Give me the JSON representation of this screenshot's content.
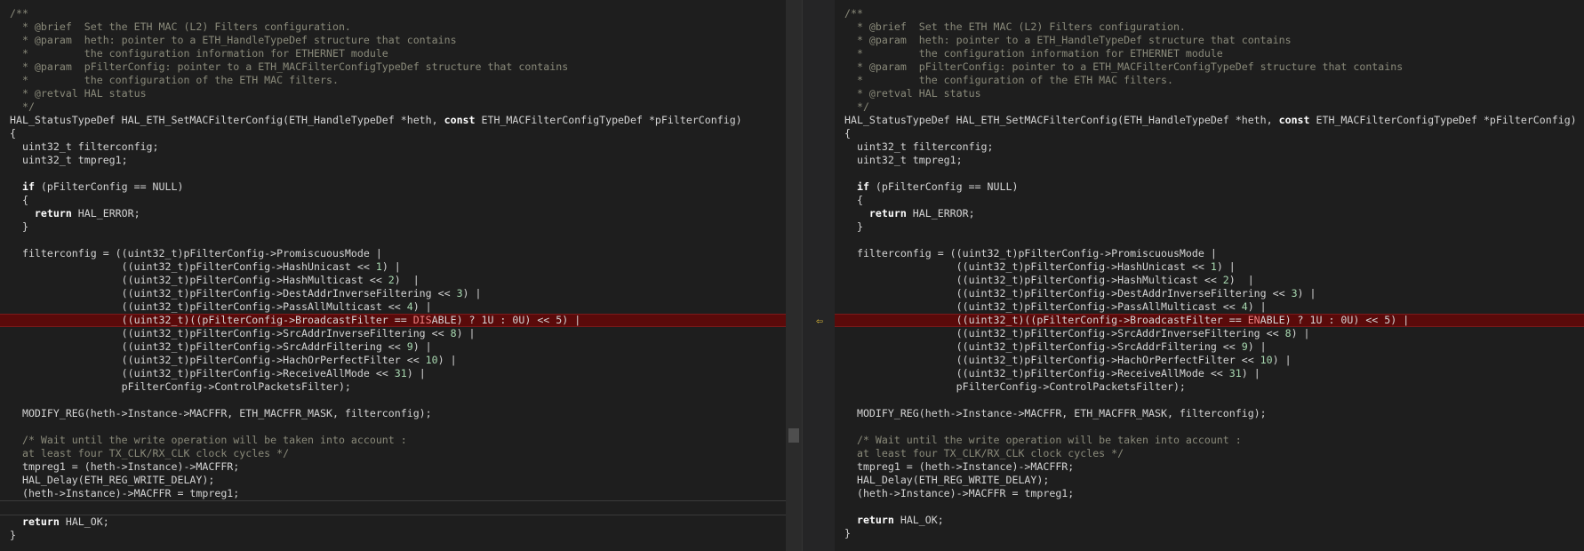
{
  "left": {
    "lines": [
      {
        "segs": [
          {
            "t": "/**",
            "c": "cm"
          }
        ]
      },
      {
        "segs": [
          {
            "t": "  * @brief  Set the ETH MAC (L2) Filters configuration.",
            "c": "cm"
          }
        ]
      },
      {
        "segs": [
          {
            "t": "  * @param  heth: pointer to a ETH_HandleTypeDef structure that contains",
            "c": "cm"
          }
        ]
      },
      {
        "segs": [
          {
            "t": "  *         the configuration information for ETHERNET module",
            "c": "cm"
          }
        ]
      },
      {
        "segs": [
          {
            "t": "  * @param  pFilterConfig: pointer to a ETH_MACFilterConfigTypeDef structure that contains",
            "c": "cm"
          }
        ]
      },
      {
        "segs": [
          {
            "t": "  *         the configuration of the ETH MAC filters.",
            "c": "cm"
          }
        ]
      },
      {
        "segs": [
          {
            "t": "  * @retval HAL status",
            "c": "cm"
          }
        ]
      },
      {
        "segs": [
          {
            "t": "  */",
            "c": "cm"
          }
        ]
      },
      {
        "segs": [
          {
            "t": "HAL_StatusTypeDef HAL_ETH_SetMACFilterConfig(ETH_HandleTypeDef *heth, "
          },
          {
            "t": "const",
            "c": "kw"
          },
          {
            "t": " ETH_MACFilterConfigTypeDef *pFilterConfig)"
          }
        ]
      },
      {
        "segs": [
          {
            "t": "{"
          }
        ]
      },
      {
        "segs": [
          {
            "t": "  uint32_t filterconfig;"
          }
        ]
      },
      {
        "segs": [
          {
            "t": "  uint32_t tmpreg1;"
          }
        ]
      },
      {
        "segs": [
          {
            "t": ""
          }
        ]
      },
      {
        "segs": [
          {
            "t": "  "
          },
          {
            "t": "if",
            "c": "kw"
          },
          {
            "t": " (pFilterConfig == NULL)"
          }
        ]
      },
      {
        "segs": [
          {
            "t": "  {"
          }
        ]
      },
      {
        "segs": [
          {
            "t": "    "
          },
          {
            "t": "return",
            "c": "kw"
          },
          {
            "t": " HAL_ERROR;"
          }
        ]
      },
      {
        "segs": [
          {
            "t": "  }"
          }
        ]
      },
      {
        "segs": [
          {
            "t": ""
          }
        ]
      },
      {
        "segs": [
          {
            "t": "  filterconfig = ((uint32_t)pFilterConfig->PromiscuousMode |"
          }
        ]
      },
      {
        "segs": [
          {
            "t": "                  ((uint32_t)pFilterConfig->HashUnicast << "
          },
          {
            "t": "1",
            "c": "num"
          },
          {
            "t": ") |"
          }
        ]
      },
      {
        "segs": [
          {
            "t": "                  ((uint32_t)pFilterConfig->HashMulticast << "
          },
          {
            "t": "2",
            "c": "num"
          },
          {
            "t": ")  |"
          }
        ]
      },
      {
        "segs": [
          {
            "t": "                  ((uint32_t)pFilterConfig->DestAddrInverseFiltering << "
          },
          {
            "t": "3",
            "c": "num"
          },
          {
            "t": ") |"
          }
        ]
      },
      {
        "segs": [
          {
            "t": "                  ((uint32_t)pFilterConfig->PassAllMulticast << "
          },
          {
            "t": "4",
            "c": "num"
          },
          {
            "t": ") |"
          }
        ]
      },
      {
        "changed": true,
        "segs": [
          {
            "t": "                  ((uint32_t)((pFilterConfig->BroadcastFilter == "
          },
          {
            "t": "DIS",
            "c": "hl-del"
          },
          {
            "t": "ABLE) ? 1U : 0U) << 5) |"
          }
        ]
      },
      {
        "segs": [
          {
            "t": "                  ((uint32_t)pFilterConfig->SrcAddrInverseFiltering << "
          },
          {
            "t": "8",
            "c": "num"
          },
          {
            "t": ") |"
          }
        ]
      },
      {
        "segs": [
          {
            "t": "                  ((uint32_t)pFilterConfig->SrcAddrFiltering << "
          },
          {
            "t": "9",
            "c": "num"
          },
          {
            "t": ") |"
          }
        ]
      },
      {
        "segs": [
          {
            "t": "                  ((uint32_t)pFilterConfig->HachOrPerfectFilter << "
          },
          {
            "t": "10",
            "c": "num"
          },
          {
            "t": ") |"
          }
        ]
      },
      {
        "segs": [
          {
            "t": "                  ((uint32_t)pFilterConfig->ReceiveAllMode << "
          },
          {
            "t": "31",
            "c": "num"
          },
          {
            "t": ") |"
          }
        ]
      },
      {
        "segs": [
          {
            "t": "                  pFilterConfig->ControlPacketsFilter);"
          }
        ]
      },
      {
        "segs": [
          {
            "t": ""
          }
        ]
      },
      {
        "segs": [
          {
            "t": "  MODIFY_REG(heth->Instance->MACFFR, ETH_MACFFR_MASK, filterconfig);"
          }
        ]
      },
      {
        "segs": [
          {
            "t": ""
          }
        ]
      },
      {
        "segs": [
          {
            "t": "  /* Wait until the write operation will be taken into account :",
            "c": "cm"
          }
        ]
      },
      {
        "segs": [
          {
            "t": "  at least four TX_CLK/RX_CLK clock cycles */",
            "c": "cm"
          }
        ]
      },
      {
        "segs": [
          {
            "t": "  tmpreg1 = (heth->Instance)->MACFFR;"
          }
        ]
      },
      {
        "segs": [
          {
            "t": "  HAL_Delay(ETH_REG_WRITE_DELAY);"
          }
        ]
      },
      {
        "sep": true,
        "segs": [
          {
            "t": "  (heth->Instance)->MACFFR = tmpreg1;"
          }
        ]
      },
      {
        "sep": true,
        "segs": [
          {
            "t": ""
          }
        ]
      },
      {
        "segs": [
          {
            "t": "  "
          },
          {
            "t": "return",
            "c": "kw"
          },
          {
            "t": " HAL_OK;"
          }
        ]
      },
      {
        "segs": [
          {
            "t": "}"
          }
        ]
      }
    ]
  },
  "right": {
    "lines": [
      {
        "segs": [
          {
            "t": "/**",
            "c": "cm"
          }
        ]
      },
      {
        "segs": [
          {
            "t": "  * @brief  Set the ETH MAC (L2) Filters configuration.",
            "c": "cm"
          }
        ]
      },
      {
        "segs": [
          {
            "t": "  * @param  heth: pointer to a ETH_HandleTypeDef structure that contains",
            "c": "cm"
          }
        ]
      },
      {
        "segs": [
          {
            "t": "  *         the configuration information for ETHERNET module",
            "c": "cm"
          }
        ]
      },
      {
        "segs": [
          {
            "t": "  * @param  pFilterConfig: pointer to a ETH_MACFilterConfigTypeDef structure that contains",
            "c": "cm"
          }
        ]
      },
      {
        "segs": [
          {
            "t": "  *         the configuration of the ETH MAC filters.",
            "c": "cm"
          }
        ]
      },
      {
        "segs": [
          {
            "t": "  * @retval HAL status",
            "c": "cm"
          }
        ]
      },
      {
        "segs": [
          {
            "t": "  */",
            "c": "cm"
          }
        ]
      },
      {
        "segs": [
          {
            "t": "HAL_StatusTypeDef HAL_ETH_SetMACFilterConfig(ETH_HandleTypeDef *heth, "
          },
          {
            "t": "const",
            "c": "kw"
          },
          {
            "t": " ETH_MACFilterConfigTypeDef *pFilterConfig)"
          }
        ]
      },
      {
        "segs": [
          {
            "t": "{"
          }
        ]
      },
      {
        "segs": [
          {
            "t": "  uint32_t filterconfig;"
          }
        ]
      },
      {
        "segs": [
          {
            "t": "  uint32_t tmpreg1;"
          }
        ]
      },
      {
        "segs": [
          {
            "t": ""
          }
        ]
      },
      {
        "segs": [
          {
            "t": "  "
          },
          {
            "t": "if",
            "c": "kw"
          },
          {
            "t": " (pFilterConfig == NULL)"
          }
        ]
      },
      {
        "segs": [
          {
            "t": "  {"
          }
        ]
      },
      {
        "segs": [
          {
            "t": "    "
          },
          {
            "t": "return",
            "c": "kw"
          },
          {
            "t": " HAL_ERROR;"
          }
        ]
      },
      {
        "segs": [
          {
            "t": "  }"
          }
        ]
      },
      {
        "segs": [
          {
            "t": ""
          }
        ]
      },
      {
        "segs": [
          {
            "t": "  filterconfig = ((uint32_t)pFilterConfig->PromiscuousMode |"
          }
        ]
      },
      {
        "segs": [
          {
            "t": "                  ((uint32_t)pFilterConfig->HashUnicast << "
          },
          {
            "t": "1",
            "c": "num"
          },
          {
            "t": ") |"
          }
        ]
      },
      {
        "segs": [
          {
            "t": "                  ((uint32_t)pFilterConfig->HashMulticast << "
          },
          {
            "t": "2",
            "c": "num"
          },
          {
            "t": ")  |"
          }
        ]
      },
      {
        "segs": [
          {
            "t": "                  ((uint32_t)pFilterConfig->DestAddrInverseFiltering << "
          },
          {
            "t": "3",
            "c": "num"
          },
          {
            "t": ") |"
          }
        ]
      },
      {
        "segs": [
          {
            "t": "                  ((uint32_t)pFilterConfig->PassAllMulticast << "
          },
          {
            "t": "4",
            "c": "num"
          },
          {
            "t": ") |"
          }
        ]
      },
      {
        "changed": true,
        "segs": [
          {
            "t": "                  ((uint32_t)((pFilterConfig->BroadcastFilter == "
          },
          {
            "t": "EN",
            "c": "hl-add"
          },
          {
            "t": "ABLE) ? 1U : 0U) << 5) |"
          }
        ]
      },
      {
        "segs": [
          {
            "t": "                  ((uint32_t)pFilterConfig->SrcAddrInverseFiltering << "
          },
          {
            "t": "8",
            "c": "num"
          },
          {
            "t": ") |"
          }
        ]
      },
      {
        "segs": [
          {
            "t": "                  ((uint32_t)pFilterConfig->SrcAddrFiltering << "
          },
          {
            "t": "9",
            "c": "num"
          },
          {
            "t": ") |"
          }
        ]
      },
      {
        "segs": [
          {
            "t": "                  ((uint32_t)pFilterConfig->HachOrPerfectFilter << "
          },
          {
            "t": "10",
            "c": "num"
          },
          {
            "t": ") |"
          }
        ]
      },
      {
        "segs": [
          {
            "t": "                  ((uint32_t)pFilterConfig->ReceiveAllMode << "
          },
          {
            "t": "31",
            "c": "num"
          },
          {
            "t": ") |"
          }
        ]
      },
      {
        "segs": [
          {
            "t": "                  pFilterConfig->ControlPacketsFilter);"
          }
        ]
      },
      {
        "segs": [
          {
            "t": ""
          }
        ]
      },
      {
        "segs": [
          {
            "t": "  MODIFY_REG(heth->Instance->MACFFR, ETH_MACFFR_MASK, filterconfig);"
          }
        ]
      },
      {
        "segs": [
          {
            "t": ""
          }
        ]
      },
      {
        "segs": [
          {
            "t": "  /* Wait until the write operation will be taken into account :",
            "c": "cm"
          }
        ]
      },
      {
        "segs": [
          {
            "t": "  at least four TX_CLK/RX_CLK clock cycles */",
            "c": "cm"
          }
        ]
      },
      {
        "segs": [
          {
            "t": "  tmpreg1 = (heth->Instance)->MACFFR;"
          }
        ]
      },
      {
        "segs": [
          {
            "t": "  HAL_Delay(ETH_REG_WRITE_DELAY);"
          }
        ]
      },
      {
        "segs": [
          {
            "t": "  (heth->Instance)->MACFFR = tmpreg1;"
          }
        ]
      },
      {
        "segs": [
          {
            "t": ""
          }
        ]
      },
      {
        "segs": [
          {
            "t": "  "
          },
          {
            "t": "return",
            "c": "kw"
          },
          {
            "t": " HAL_OK;"
          }
        ]
      },
      {
        "segs": [
          {
            "t": "}"
          }
        ]
      }
    ]
  },
  "gutter": {
    "copy_icon": "arrow-left-icon",
    "glyph": "⇦"
  },
  "colors": {
    "background": "#1e1e1e",
    "changed_line": "#5a0a0a",
    "comment": "#8a8a7a",
    "number": "#a8d8b0",
    "arrow": "#e8c33a"
  }
}
